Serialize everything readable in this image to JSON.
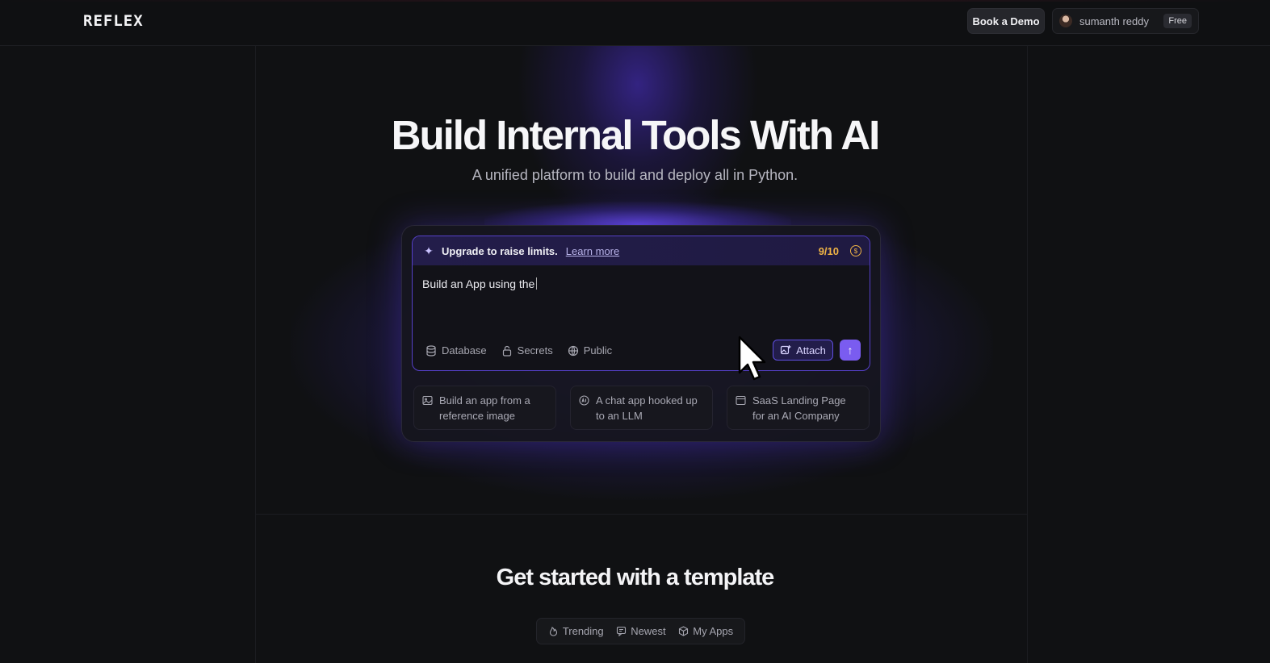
{
  "header": {
    "logo": "REFLEX",
    "book_demo_label": "Book a Demo",
    "user_name": "sumanth reddy",
    "plan_badge": "Free"
  },
  "hero": {
    "title": "Build Internal Tools With AI",
    "subtitle": "A unified platform to build and deploy all in Python."
  },
  "prompt": {
    "banner_text": "Upgrade to raise limits.",
    "learn_more_label": "Learn more",
    "usage_count": "9/10",
    "input_value": "Build an App using the",
    "options": [
      {
        "label": "Database",
        "icon": "database-icon"
      },
      {
        "label": "Secrets",
        "icon": "lock-icon"
      },
      {
        "label": "Public",
        "icon": "globe-icon"
      }
    ],
    "attach_label": "Attach",
    "send_icon": "arrow-up-icon"
  },
  "suggestions": [
    {
      "text": "Build an app from a reference image",
      "icon": "image-icon"
    },
    {
      "text": "A chat app hooked up to an LLM",
      "icon": "ai-chip-icon"
    },
    {
      "text": "SaaS Landing Page for an AI Company",
      "icon": "browser-window-icon"
    }
  ],
  "templates": {
    "title": "Get started with a template",
    "filters": [
      {
        "label": "Trending",
        "icon": "flame-icon"
      },
      {
        "label": "Newest",
        "icon": "message-square-icon"
      },
      {
        "label": "My Apps",
        "icon": "cube-icon"
      }
    ]
  },
  "colors": {
    "accent": "#7a5cf0",
    "background": "#101113",
    "usage_count": "#f0b445"
  }
}
